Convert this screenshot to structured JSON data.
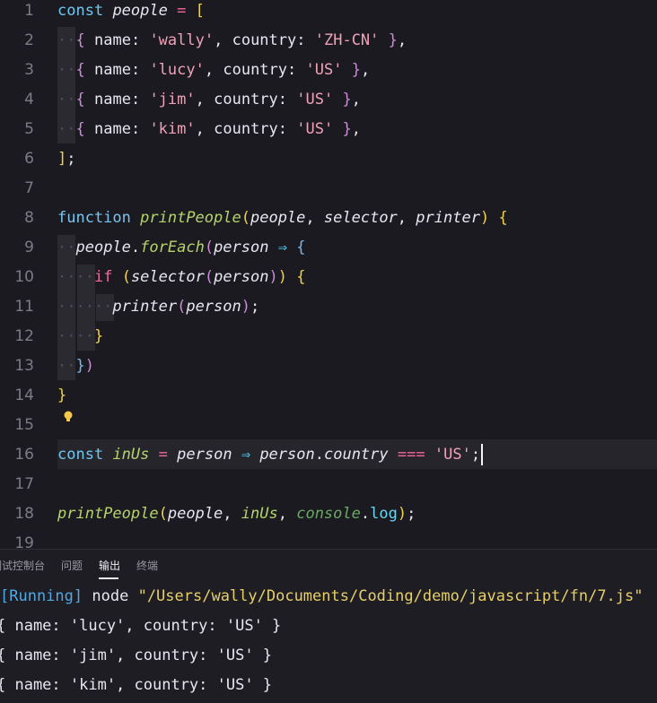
{
  "editor": {
    "lines": [
      {
        "n": "1"
      },
      {
        "n": "2"
      },
      {
        "n": "3"
      },
      {
        "n": "4"
      },
      {
        "n": "5"
      },
      {
        "n": "6"
      },
      {
        "n": "7"
      },
      {
        "n": "8"
      },
      {
        "n": "9"
      },
      {
        "n": "10"
      },
      {
        "n": "11"
      },
      {
        "n": "12"
      },
      {
        "n": "13"
      },
      {
        "n": "14"
      },
      {
        "n": "15"
      },
      {
        "n": "16"
      },
      {
        "n": "17"
      },
      {
        "n": "18"
      },
      {
        "n": "19"
      }
    ],
    "tokens": {
      "const": "const",
      "people": "people",
      "eq": "=",
      "lbr": "[",
      "rbr": "]",
      "semi": ";",
      "lcb": "{",
      "rcb": "}",
      "name_key": "name",
      "country_key": "country",
      "colon": ":",
      "comma": ",",
      "wally": "'wally'",
      "lucy": "'lucy'",
      "jim": "'jim'",
      "kim": "'kim'",
      "zhcn": "'ZH-CN'",
      "us": "'US'",
      "function": "function",
      "printPeople": "printPeople",
      "lp": "(",
      "rp": ")",
      "selector": "selector",
      "printer": "printer",
      "forEach": "forEach",
      "person": "person",
      "arrow": "⇒",
      "if": "if",
      "dot": ".",
      "inUs": "inUs",
      "country": "country",
      "triple_eq": "===",
      "console": "console",
      "log": "log",
      "dots2": "··",
      "dots4": "····",
      "dots6": "······"
    }
  },
  "panel": {
    "tabs": [
      "调试控制台",
      "问题",
      "输出",
      "终端"
    ],
    "active_tab": "输出",
    "output": {
      "running": "[Running]",
      "command": "node",
      "path": "\"/Users/wally/Documents/Coding/demo/javascript/fn/7.js\"",
      "lines": [
        "{ name: 'lucy', country: 'US' }",
        "{ name: 'jim', country: 'US' }",
        "{ name: 'kim', country: 'US' }"
      ]
    }
  }
}
